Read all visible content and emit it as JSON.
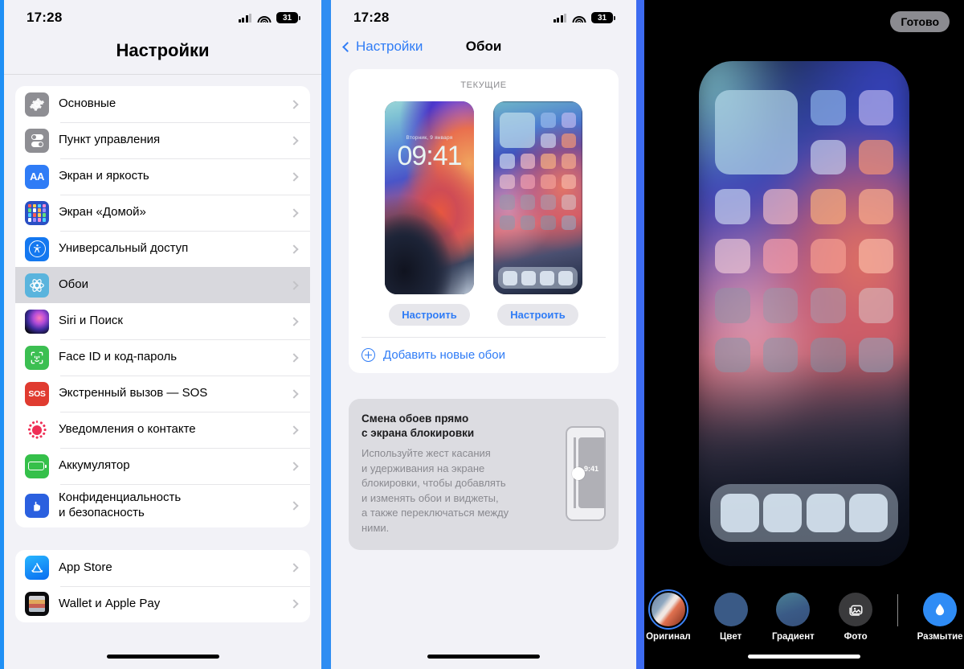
{
  "statusbar": {
    "time": "17:28",
    "battery": "31"
  },
  "panel1": {
    "title": "Настройки",
    "groups": [
      {
        "items": [
          {
            "label": "Основные",
            "icon": "gear-icon"
          },
          {
            "label": "Пункт управления",
            "icon": "control-center-icon"
          },
          {
            "label": "Экран и яркость",
            "icon": "display-brightness-icon"
          },
          {
            "label": "Экран «Домой»",
            "icon": "home-screen-icon"
          },
          {
            "label": "Универсальный доступ",
            "icon": "accessibility-icon"
          },
          {
            "label": "Обои",
            "icon": "wallpaper-icon",
            "selected": true
          },
          {
            "label": "Siri и Поиск",
            "icon": "siri-icon"
          },
          {
            "label": "Face ID и код-пароль",
            "icon": "face-id-icon"
          },
          {
            "label": "Экстренный вызов — SOS",
            "icon": "sos-icon"
          },
          {
            "label": "Уведомления о контакте",
            "icon": "contact-notification-icon"
          },
          {
            "label": "Аккумулятор",
            "icon": "battery-icon"
          },
          {
            "label": "Конфиденциальность\nи безопасность",
            "icon": "privacy-icon"
          }
        ]
      },
      {
        "items": [
          {
            "label": "App Store",
            "icon": "app-store-icon"
          },
          {
            "label": "Wallet и Apple Pay",
            "icon": "wallet-icon"
          }
        ]
      }
    ]
  },
  "panel2": {
    "back_label": "Настройки",
    "title": "Обои",
    "card_caption": "ТЕКУЩИЕ",
    "lock_preview": {
      "date": "Вторник, 9 января",
      "time": "09:41"
    },
    "customize_lock_label": "Настроить",
    "customize_home_label": "Настроить",
    "add_wallpaper_label": "Добавить новые обои",
    "tip": {
      "title": "Смена обоев прямо\nс экрана блокировки",
      "body": "Используйте жест касания\nи удерживания на экране\nблокировки, чтобы добавлять\nи изменять обои и виджеты,\nа также переключаться между\nними.",
      "phone_time": "9:41"
    }
  },
  "panel3": {
    "done_label": "Готово",
    "toolbar": [
      {
        "label": "Оригинал",
        "icon": "original-swatch-icon",
        "selected": true
      },
      {
        "label": "Цвет",
        "icon": "color-swatch-icon",
        "selected": false
      },
      {
        "label": "Градиент",
        "icon": "gradient-swatch-icon",
        "selected": false
      },
      {
        "label": "Фото",
        "icon": "photos-icon",
        "selected": false
      },
      {
        "label": "Размытие",
        "icon": "blur-droplet-icon",
        "selected": false
      }
    ]
  },
  "colors": {
    "accent_blue": "#2f7cf6",
    "divider_blue_left": "#2f8df2",
    "divider_blue_right": "#3d6bf0",
    "panel_bg": "#f2f2f7",
    "selected_row": "#d8d8dd"
  }
}
